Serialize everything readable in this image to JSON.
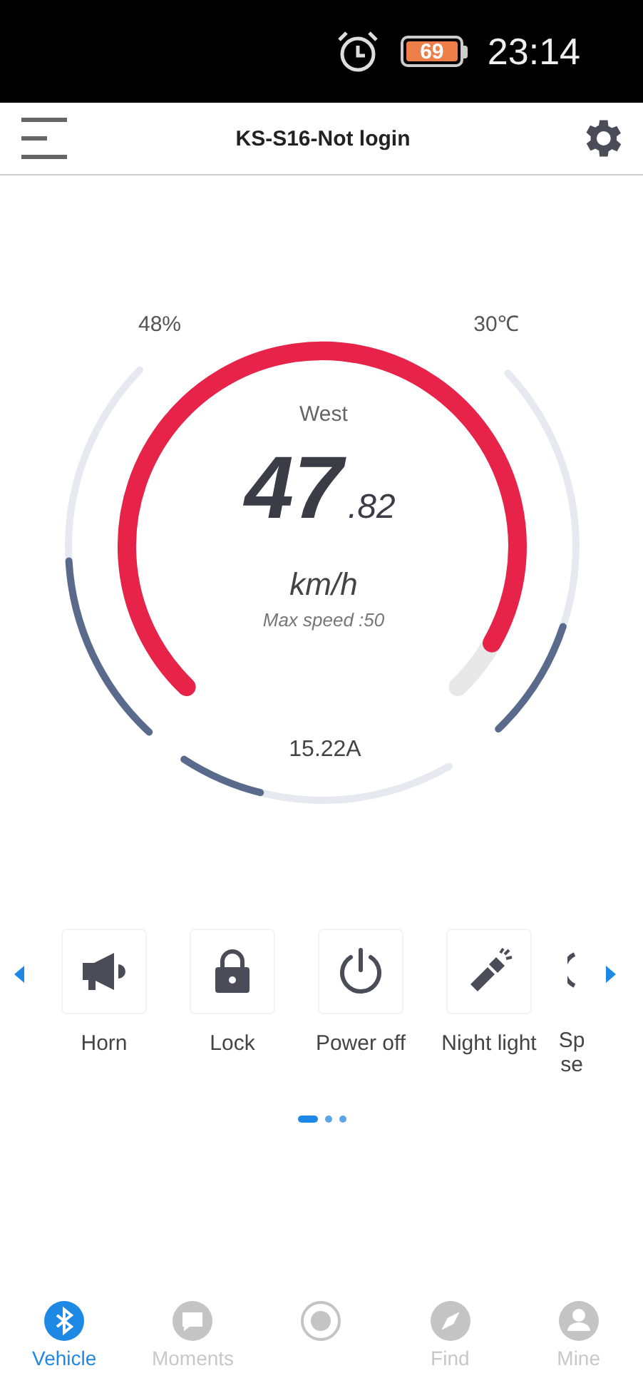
{
  "status_bar": {
    "battery": "69",
    "time": "23:14"
  },
  "header": {
    "title": "KS-S16-Not login"
  },
  "gauge": {
    "direction": "West",
    "speed_whole": "47",
    "speed_decimal": ".82",
    "unit": "km/h",
    "max_speed": "Max speed :50",
    "battery": {
      "label": "48%"
    },
    "temperature": {
      "label": "30℃"
    },
    "current": {
      "label": "15.22A"
    }
  },
  "controls": [
    {
      "kind": "horn",
      "label": "Horn"
    },
    {
      "kind": "lock",
      "label": "Lock"
    },
    {
      "kind": "power",
      "label": "Power off"
    },
    {
      "kind": "light",
      "label": "Night light"
    },
    {
      "kind": "partial",
      "label": "Sp se"
    }
  ],
  "pager": [
    {
      "selected": true
    },
    {
      "selected": false
    },
    {
      "selected": false
    }
  ],
  "tabs": [
    {
      "kind": "bluetooth",
      "label": "Vehicle",
      "selected": true
    },
    {
      "kind": "chat",
      "label": "Moments",
      "selected": false
    },
    {
      "kind": "record",
      "selected": false
    },
    {
      "kind": "find",
      "label": "Find",
      "selected": false
    },
    {
      "kind": "person",
      "label": "Mine",
      "selected": false
    }
  ]
}
